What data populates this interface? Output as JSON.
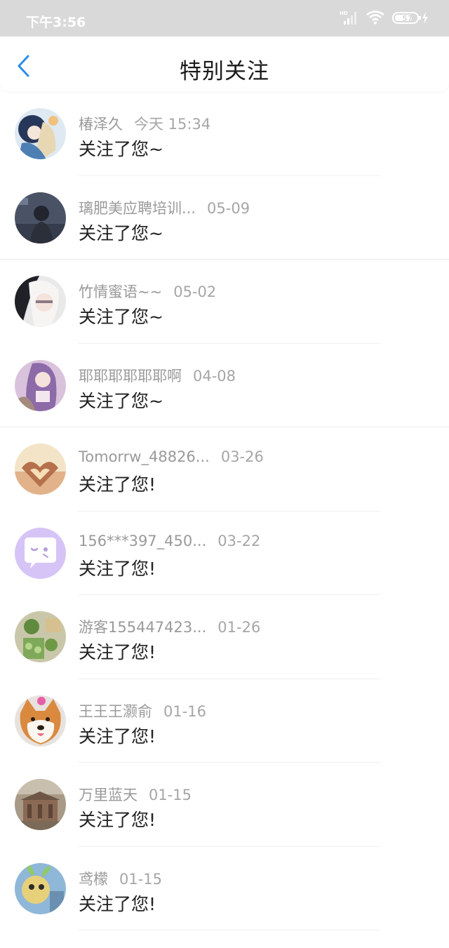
{
  "status": {
    "time": "下午3:56",
    "battery": "57",
    "hd_label": "HD"
  },
  "header": {
    "title": "特别关注"
  },
  "colors": {
    "accent": "#2b8de8",
    "status_bar_bg": "#d9d9d9"
  },
  "items": [
    {
      "name": "椿泽久",
      "time": "今天 15:34",
      "message": "关注了您~",
      "avatar": "anime-girl-blue-avatar"
    },
    {
      "name": "璃肥美应聘培训...",
      "time": "05-09",
      "message": "关注了您~",
      "avatar": "dark-photo-avatar"
    },
    {
      "name": "竹情蜜语~~",
      "time": "05-02",
      "message": "关注了您~",
      "avatar": "white-hair-anime-avatar"
    },
    {
      "name": "耶耶耶耶耶耶啊",
      "time": "04-08",
      "message": "关注了您~",
      "avatar": "purple-anime-girl-avatar"
    },
    {
      "name": "Tomorrw_48826...",
      "time": "03-26",
      "message": "关注了您!",
      "avatar": "heart-hands-avatar"
    },
    {
      "name": "156***397_450...",
      "time": "03-22",
      "message": "关注了您!",
      "avatar": "chat-bubble-avatar"
    },
    {
      "name": "游客155447423...",
      "time": "01-26",
      "message": "关注了您!",
      "avatar": "matcha-food-avatar"
    },
    {
      "name": "王王王灏俞",
      "time": "01-16",
      "message": "关注了您!",
      "avatar": "shiba-dog-avatar"
    },
    {
      "name": "万里蓝天",
      "time": "01-15",
      "message": "关注了您!",
      "avatar": "building-photo-avatar"
    },
    {
      "name": "鸢檬",
      "time": "01-15",
      "message": "关注了您!",
      "avatar": "plush-toy-avatar"
    }
  ]
}
